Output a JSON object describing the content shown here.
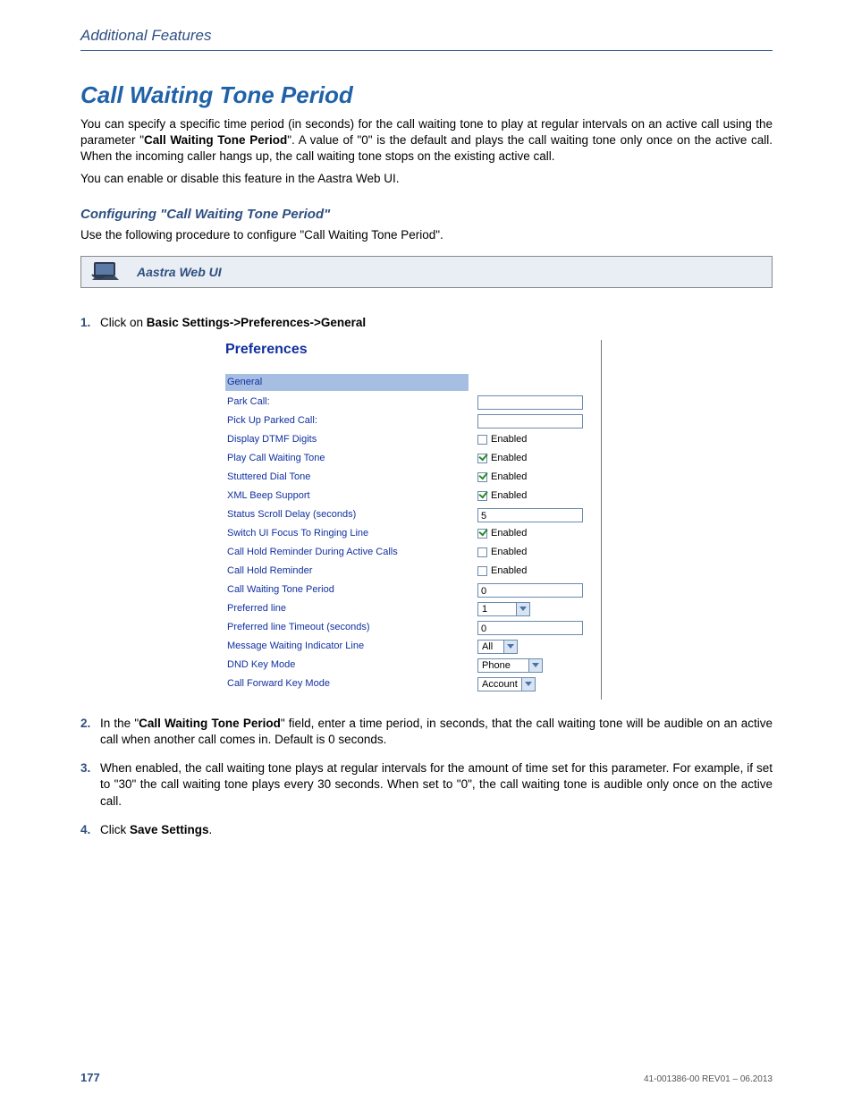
{
  "running_head": "Additional Features",
  "section_title": "Call Waiting Tone Period",
  "p1_a": "You can specify a specific time period (in seconds) for the call waiting tone to play at regular intervals on an active call using the parameter \"",
  "p1_bold": "Call Waiting Tone Period",
  "p1_b": "\". A value of \"0\" is the default and plays the call waiting tone only once on the active call. When the incoming caller hangs up, the call waiting tone stops on the existing active call.",
  "p2": "You can enable or disable this feature in the Aastra Web UI.",
  "subheading": "Configuring \"Call Waiting Tone Period\"",
  "p3": "Use the following procedure to configure \"Call Waiting Tone Period\".",
  "aastra_bar_label": "Aastra Web UI",
  "steps": {
    "s1_a": "Click on ",
    "s1_b": "Basic Settings->Preferences->General",
    "s2_a": "In the \"",
    "s2_b": "Call Waiting Tone Period",
    "s2_c": "\" field, enter a time period, in seconds, that the call waiting tone will be audible on an active call when another call comes in. Default is 0 seconds.",
    "s3": "When enabled, the call waiting tone plays at regular intervals for the amount of time set for this parameter. For example, if set to \"30\" the call waiting tone plays every 30 seconds. When set to \"0\", the call waiting tone is audible only once on the active call.",
    "s4_a": "Click ",
    "s4_b": "Save Settings",
    "s4_c": "."
  },
  "prefs": {
    "title": "Preferences",
    "header": "General",
    "rows": {
      "park": {
        "label": "Park Call:",
        "value": ""
      },
      "pickup": {
        "label": "Pick Up Parked Call:",
        "value": ""
      },
      "dtmf": {
        "label": "Display DTMF Digits",
        "enabled": "Enabled"
      },
      "playcw": {
        "label": "Play Call Waiting Tone",
        "enabled": "Enabled"
      },
      "stutter": {
        "label": "Stuttered Dial Tone",
        "enabled": "Enabled"
      },
      "xml": {
        "label": "XML Beep Support",
        "enabled": "Enabled"
      },
      "scroll": {
        "label": "Status Scroll Delay (seconds)",
        "value": "5"
      },
      "switchui": {
        "label": "Switch UI Focus To Ringing Line",
        "enabled": "Enabled"
      },
      "holdrem_active": {
        "label": "Call Hold Reminder During Active Calls",
        "enabled": "Enabled"
      },
      "holdrem": {
        "label": "Call Hold Reminder",
        "enabled": "Enabled"
      },
      "cwperiod": {
        "label": "Call Waiting Tone Period",
        "value": "0"
      },
      "prefline": {
        "label": "Preferred line",
        "value": "1"
      },
      "preflinetimeout": {
        "label": "Preferred line Timeout (seconds)",
        "value": "0"
      },
      "mwi": {
        "label": "Message Waiting Indicator Line",
        "value": "All"
      },
      "dnd": {
        "label": "DND Key Mode",
        "value": "Phone"
      },
      "cfwd": {
        "label": "Call Forward Key Mode",
        "value": "Account"
      }
    }
  },
  "footer": {
    "page": "177",
    "docid": "41-001386-00 REV01 – 06.2013"
  }
}
